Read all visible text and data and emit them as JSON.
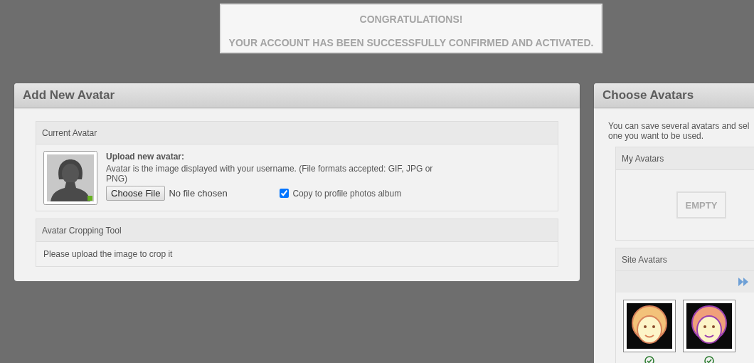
{
  "notice": {
    "title": "CONGRATULATIONS!",
    "message": "YOUR ACCOUNT HAS BEEN SUCCESSFULLY CONFIRMED AND ACTIVATED."
  },
  "add_avatar": {
    "title": "Add New Avatar",
    "current": {
      "heading": "Current Avatar",
      "upload_label": "Upload new avatar:",
      "description": "Avatar is the image displayed with your username. (File formats accepted: GIF, JPG or PNG)",
      "file_button": "Choose File",
      "file_status": "No file chosen",
      "copy_option": {
        "label": "Copy to profile photos album",
        "checked": true
      }
    },
    "cropping": {
      "heading": "Avatar Cropping Tool",
      "message": "Please upload the image to crop it"
    }
  },
  "choose_avatars": {
    "title": "Choose Avatars",
    "intro_line_1": "You can save several avatars and sel",
    "intro_line_2": "one you want to be used.",
    "my_avatars": {
      "heading": "My Avatars",
      "empty_label": "EMPTY"
    },
    "site_avatars": {
      "heading": "Site Avatars"
    }
  }
}
